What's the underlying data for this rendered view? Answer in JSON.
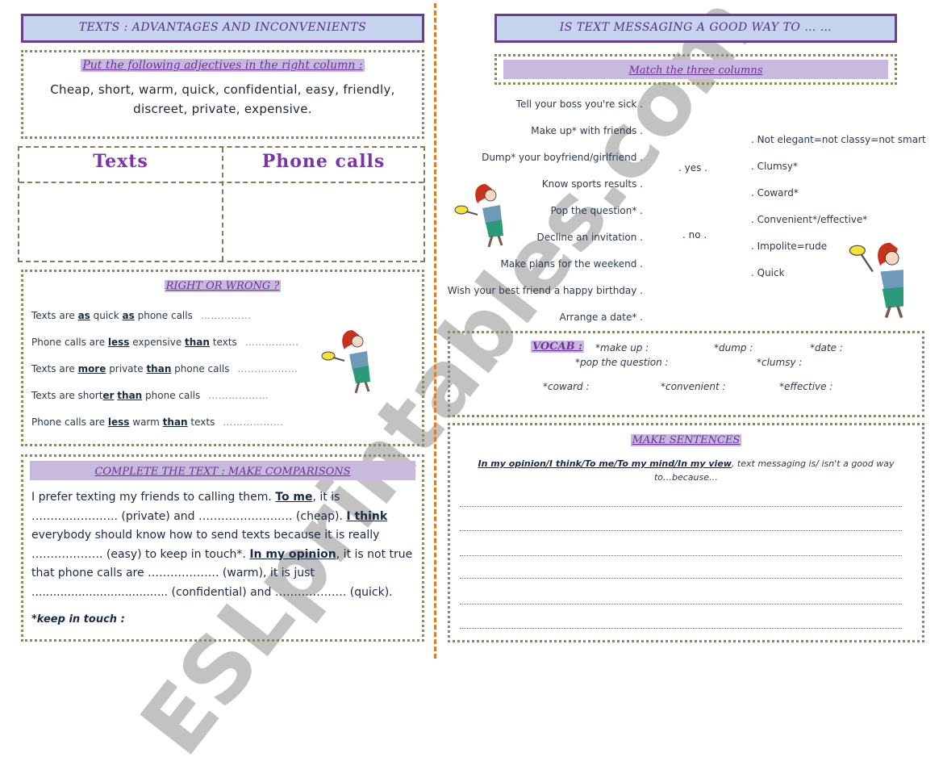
{
  "left": {
    "banner_title": "TEXTS : ADVANTAGES AND INCONVENIENTS",
    "adjectives": {
      "instruction": "Put the following adjectives in the right column :",
      "line1": "Cheap, short, warm, quick, confidential, easy, friendly,",
      "line2": "discreet, private, expensive."
    },
    "table": {
      "col1": "Texts",
      "col2": "Phone calls"
    },
    "right_or_wrong": {
      "title": "RIGHT OR WRONG ?",
      "items": [
        {
          "p1": "Texts are ",
          "b1": "as",
          "p2": " quick ",
          "b2": "as",
          "p3": " phone calls",
          "dots": "……………"
        },
        {
          "p1": "Phone calls are ",
          "b1": "less",
          "p2": " expensive ",
          "b2": "than",
          "p3": " texts",
          "dots": "……………."
        },
        {
          "p1": "Texts are ",
          "b1": "more",
          "p2": " private ",
          "b2": "than",
          "p3": " phone calls",
          "dots": "………………"
        },
        {
          "p1": "Texts are short",
          "b1": "er",
          "p2": " ",
          "b2": "than",
          "p3": " phone calls",
          "dots": "………………"
        },
        {
          "p1": "Phone calls are ",
          "b1": "less",
          "p2": " warm ",
          "b2": "than",
          "p3": " texts",
          "dots": "………………"
        }
      ]
    },
    "complete": {
      "title": "COMPLETE THE TEXT : MAKE COMPARISONS",
      "s1": "I prefer texting my friends to calling them. ",
      "k1": "To me",
      "s2": ", it is ………………….. (private) and ……………………. (cheap). ",
      "k2": "I think",
      "s3": " everybody should know how to send texts because it is really ………………. (easy) to keep in touch*. ",
      "k3": "In my opinion",
      "s4": ", it is not true that phone calls are ………………. (warm), it is just ...................................... (confidential) and ………………. (quick).",
      "footnote": "*keep in touch :"
    }
  },
  "right": {
    "banner_title": "IS TEXT MESSAGING A GOOD WAY TO … …",
    "match": {
      "title": "Match the three columns",
      "activities": [
        "Tell your boss you're sick .",
        "Make up* with friends .",
        "Dump* your boyfriend/girlfriend .",
        "Know sports results .",
        "Pop the question* .",
        "Decline an invitation .",
        "Make plans for the weekend .",
        "Wish your best friend a happy birthday .",
        "Arrange a date* ."
      ],
      "answers": [
        ". yes .",
        ". no ."
      ],
      "reasons": [
        ". Not elegant=not classy=not smart",
        ". Clumsy*",
        ". Coward*",
        ". Convenient*/effective*",
        ". Impolite=rude",
        ". Quick"
      ]
    },
    "vocab": {
      "label": "VOCAB :",
      "words": [
        "*make up :",
        "*dump :",
        "*date :",
        "*pop the question :",
        "*clumsy :",
        "*coward :",
        "*convenient :",
        "*effective :"
      ]
    },
    "sentences": {
      "title": "MAKE SENTENCES",
      "phrases": "In my opinion/I think/To me/To my mind/In my view",
      "prompt": ", text messaging is/ isn't a good way to…because…"
    }
  },
  "watermark": "ESLprintables.com"
}
